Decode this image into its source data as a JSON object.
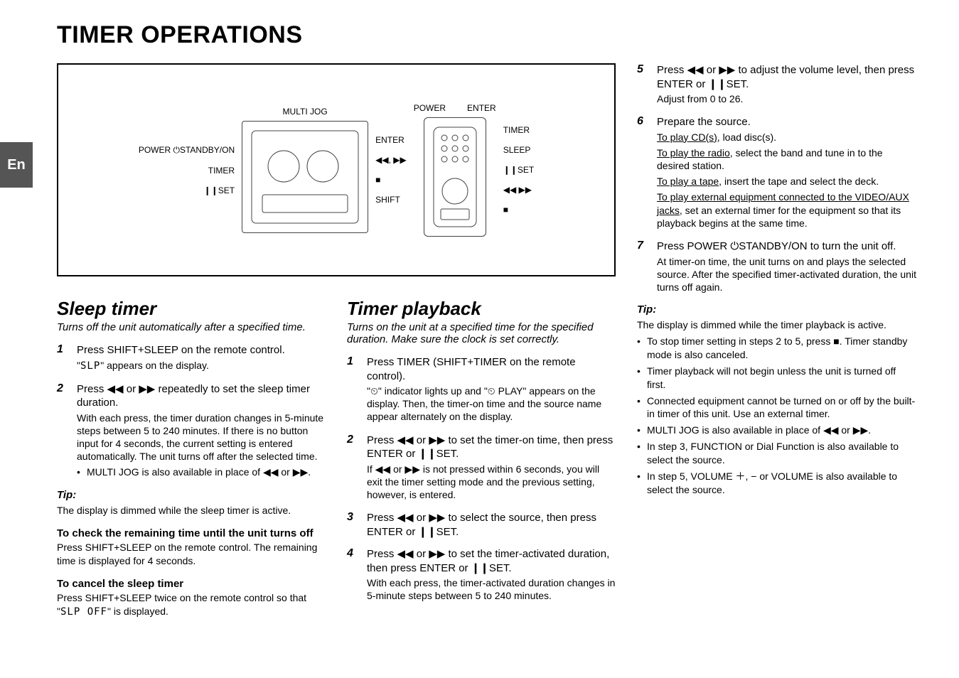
{
  "side_tab": "En",
  "title": "TIMER OPERATIONS",
  "diagram": {
    "top_labels": [
      "MULTI JOG",
      "POWER",
      "ENTER"
    ],
    "left_labels": [
      "POWER ⏻STANDBY/ON",
      "TIMER",
      "❙❙SET"
    ],
    "mid_labels": [
      "ENTER",
      "◀◀, ▶▶",
      "■",
      "SHIFT"
    ],
    "right_labels": [
      "TIMER",
      "SLEEP",
      "❙❙SET",
      "◀◀     ▶▶",
      "■"
    ]
  },
  "sleep": {
    "heading": "Sleep timer",
    "subtitle": "Turns off the unit automatically after a specified time.",
    "step1_a": "Press SHIFT+SLEEP on the remote control.",
    "step1_b": "\"SLP\" appears on the display.",
    "step2_a": "Press ◀◀ or ▶▶ repeatedly to set the sleep timer duration.",
    "step2_b": "With each press, the timer duration changes in 5-minute steps between 5 to 240 minutes. If there is no button input for 4 seconds, the current setting is entered automatically. The unit turns off after the selected time.",
    "step2_bullet": "MULTI JOG is also available in place of ◀◀ or ▶▶.",
    "tip_label": "Tip:",
    "tip_body": "The display is dimmed while the sleep timer is active.",
    "check_heading": "To check the remaining time until the unit turns off",
    "check_body": "Press SHIFT+SLEEP on the remote control. The remaining time is displayed for 4 seconds.",
    "cancel_heading": "To cancel the sleep timer",
    "cancel_body_a": "Press SHIFT+SLEEP twice on the remote control so that \"",
    "cancel_body_seg": "SLP OFF",
    "cancel_body_b": "\" is displayed."
  },
  "playback": {
    "heading": "Timer playback",
    "subtitle": "Turns on the unit at a specified time for the specified duration. Make sure the clock is set correctly.",
    "step1_a": "Press TIMER (SHIFT+TIMER on the remote control).",
    "step1_b": "\"⏲\" indicator lights up and \"⏲ PLAY\" appears on the display. Then, the timer-on time and the source name appear alternately on the display.",
    "step2_a": "Press ◀◀ or ▶▶ to set the timer-on time, then press ENTER or ❙❙SET.",
    "step2_b": "If ◀◀ or ▶▶ is not pressed within 6 seconds, you will exit the timer setting mode and the previous setting, however, is entered.",
    "step3_a": "Press ◀◀ or ▶▶ to select the source, then press ENTER or ❙❙SET.",
    "step4_a": "Press ◀◀ or ▶▶ to set the timer-activated duration, then press ENTER or ❙❙SET.",
    "step4_b": "With each press, the timer-activated duration changes in 5-minute steps between 5 to 240 minutes.",
    "step5_a": "Press ◀◀ or ▶▶ to adjust the volume level, then press ENTER or ❙❙SET.",
    "step5_b": "Adjust from 0 to 26.",
    "step6_a": "Prepare the source.",
    "step6_lines": [
      {
        "u": "To play CD(s)",
        "t": ", load disc(s)."
      },
      {
        "u": "To play the radio",
        "t": ", select the band and tune in to the desired station."
      },
      {
        "u": "To play a tape",
        "t": ", insert the tape and select the deck."
      },
      {
        "u": "To play external equipment connected to the VIDEO/AUX jacks",
        "t": ", set an external timer for the equipment so that its playback begins at the same time."
      }
    ],
    "step7_a": "Press POWER ⏻STANDBY/ON to turn the unit off.",
    "step7_b": "At timer-on time, the unit turns on and plays the selected source. After the specified timer-activated duration, the unit turns off again.",
    "tip_label": "Tip:",
    "tip_body": "The display is dimmed while the timer playback is active.",
    "tip_bullets": [
      "To stop timer setting in steps 2 to 5, press ■. Timer standby mode is also canceled.",
      "Timer playback will not begin unless the unit is turned off first.",
      "Connected equipment cannot be turned on or off by the built-in timer of this unit. Use an external timer.",
      "MULTI JOG is also available in place of ◀◀ or ▶▶.",
      "In step 3, FUNCTION or Dial Function is also available to select the source.",
      "In step 5, VOLUME ＋, − or VOLUME is also available to select the source."
    ]
  }
}
